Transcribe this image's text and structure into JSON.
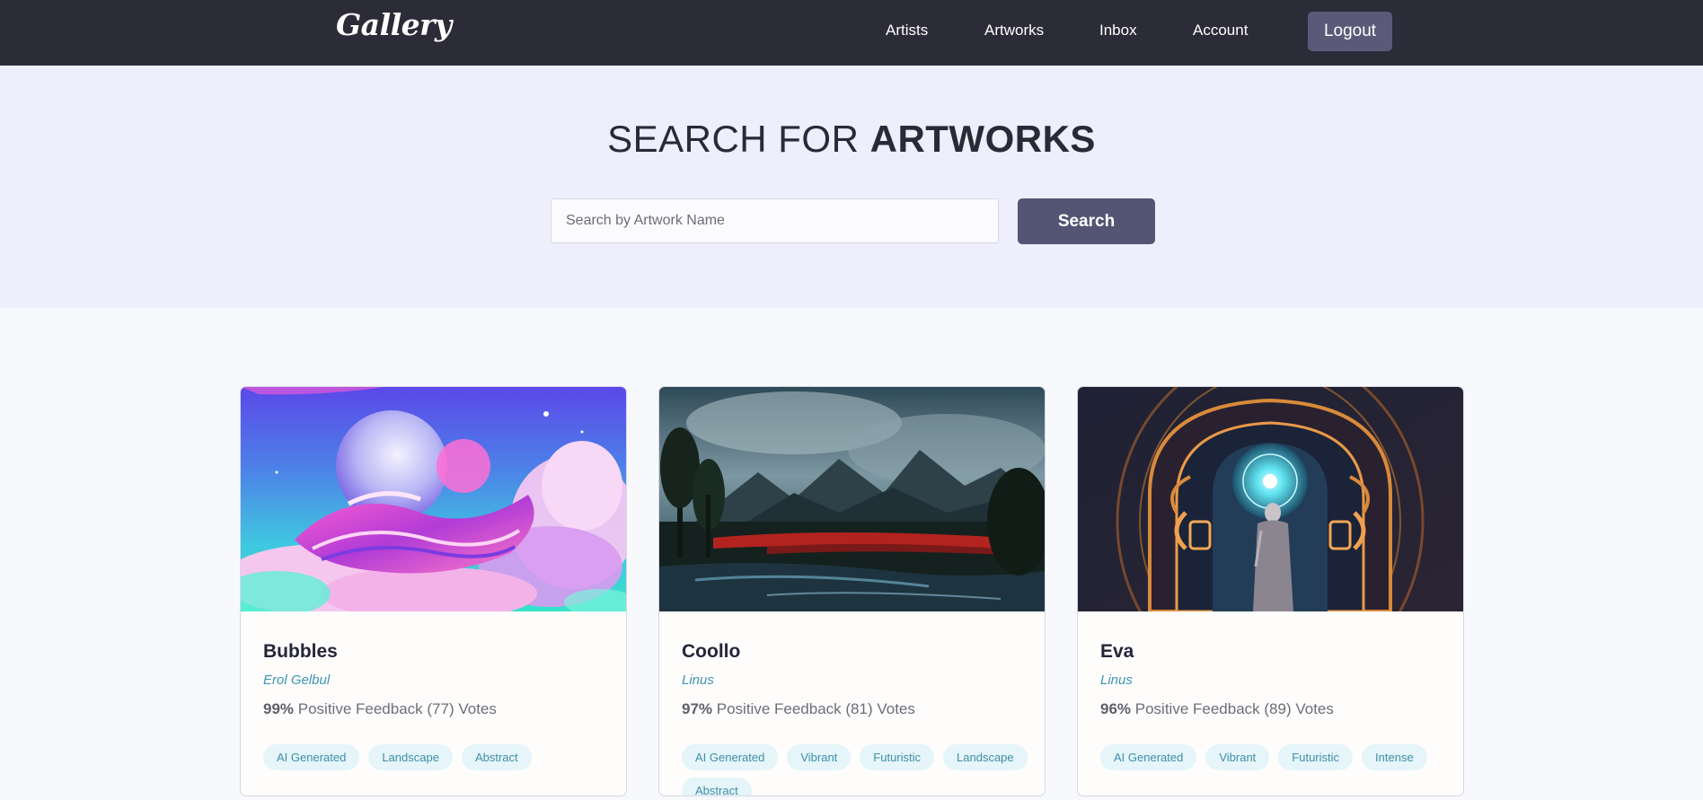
{
  "nav": {
    "logo": "Gallery",
    "links": [
      "Artists",
      "Artworks",
      "Inbox",
      "Account"
    ],
    "logout": "Logout"
  },
  "hero": {
    "title_light": "SEARCH FOR ",
    "title_bold": "ARTWORKS",
    "search_placeholder": "Search by Artwork Name",
    "search_button": "Search"
  },
  "artworks": [
    {
      "title": "Bubbles",
      "artist": "Erol Gelbul",
      "percent": "99%",
      "feedback": " Positive Feedback (77) Votes",
      "tags": [
        "AI Generated",
        "Landscape",
        "Abstract"
      ]
    },
    {
      "title": "Coollo",
      "artist": "Linus",
      "percent": "97%",
      "feedback": " Positive Feedback (81) Votes",
      "tags": [
        "AI Generated",
        "Vibrant",
        "Futuristic",
        "Landscape",
        "Abstract"
      ]
    },
    {
      "title": "Eva",
      "artist": "Linus",
      "percent": "96%",
      "feedback": " Positive Feedback (89) Votes",
      "tags": [
        "AI Generated",
        "Vibrant",
        "Futuristic",
        "Intense"
      ]
    }
  ],
  "colors": {
    "navbar": "#2c2b38",
    "hero_bg": "#eeeefc",
    "button": "#545474",
    "artist_link": "#3f94b2",
    "tag_bg": "#e5f5fa"
  }
}
